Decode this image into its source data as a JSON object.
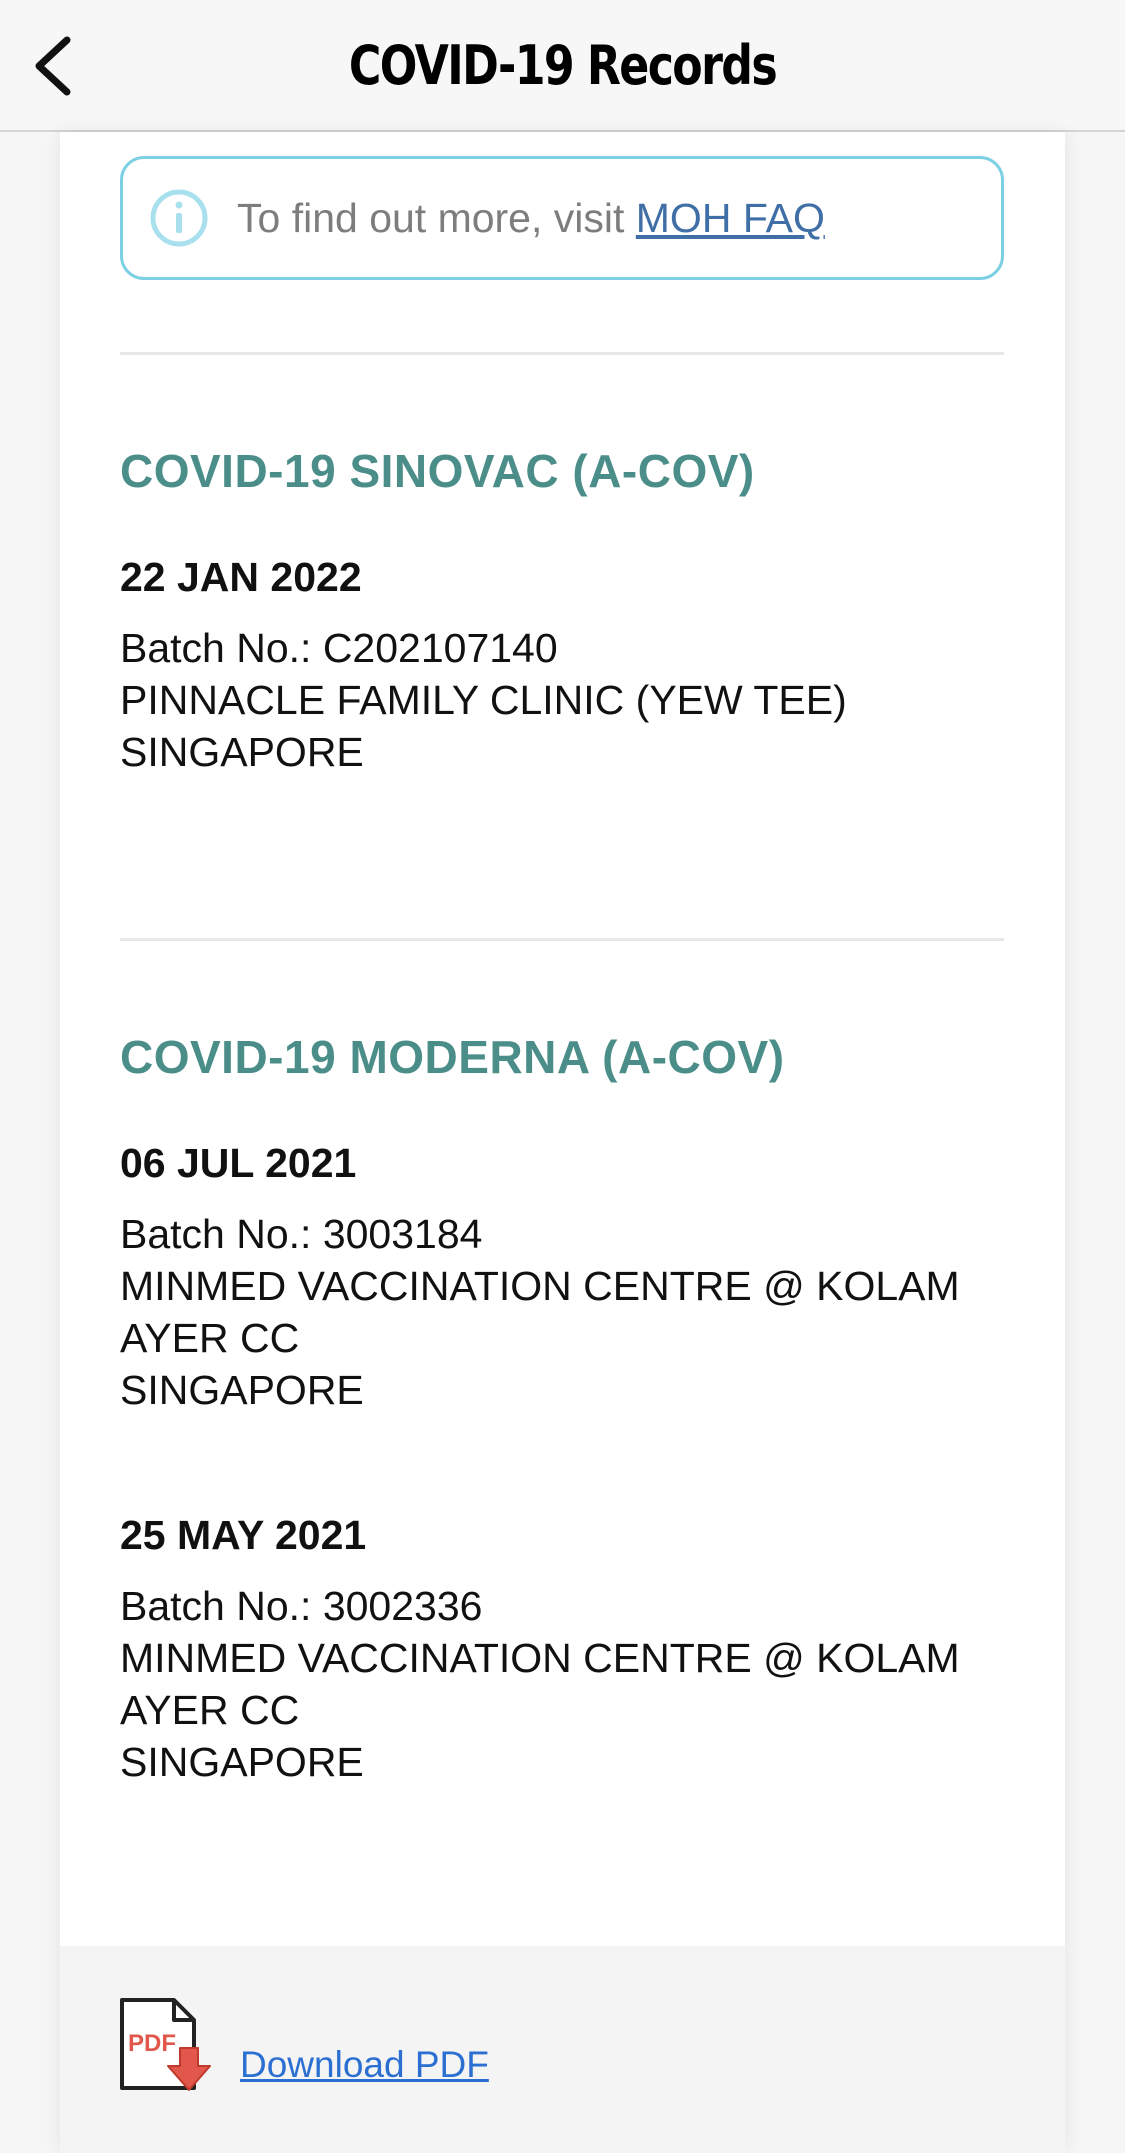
{
  "header": {
    "title": "COVID-19 Records",
    "back_icon": "chevron-left-icon"
  },
  "info": {
    "text": "To find out more, visit ",
    "link_label": "MOH FAQ",
    "icon": "info-icon",
    "border_color": "#7cd0e4"
  },
  "vaccines": [
    {
      "name": "COVID-19 SINOVAC (A-COV)",
      "doses": [
        {
          "date": "22 JAN 2022",
          "batch": "Batch No.: C202107140",
          "location": "PINNACLE FAMILY CLINIC (YEW TEE)",
          "country": "SINGAPORE"
        }
      ]
    },
    {
      "name": "COVID-19 MODERNA (A-COV)",
      "doses": [
        {
          "date": "06 JUL 2021",
          "batch": "Batch No.: 3003184",
          "location": "MINMED VACCINATION CENTRE @ KOLAM AYER CC",
          "country": "SINGAPORE"
        },
        {
          "date": "25 MAY 2021",
          "batch": "Batch No.: 3002336",
          "location": "MINMED VACCINATION CENTRE @ KOLAM AYER CC",
          "country": "SINGAPORE"
        }
      ]
    }
  ],
  "footer": {
    "download_label": "Download PDF",
    "pdf_icon": "pdf-download-icon",
    "pdf_icon_text": "PDF"
  },
  "colors": {
    "accent": "#4b8e89",
    "link": "#2a6fd1",
    "info_link": "#3f6fa6"
  }
}
